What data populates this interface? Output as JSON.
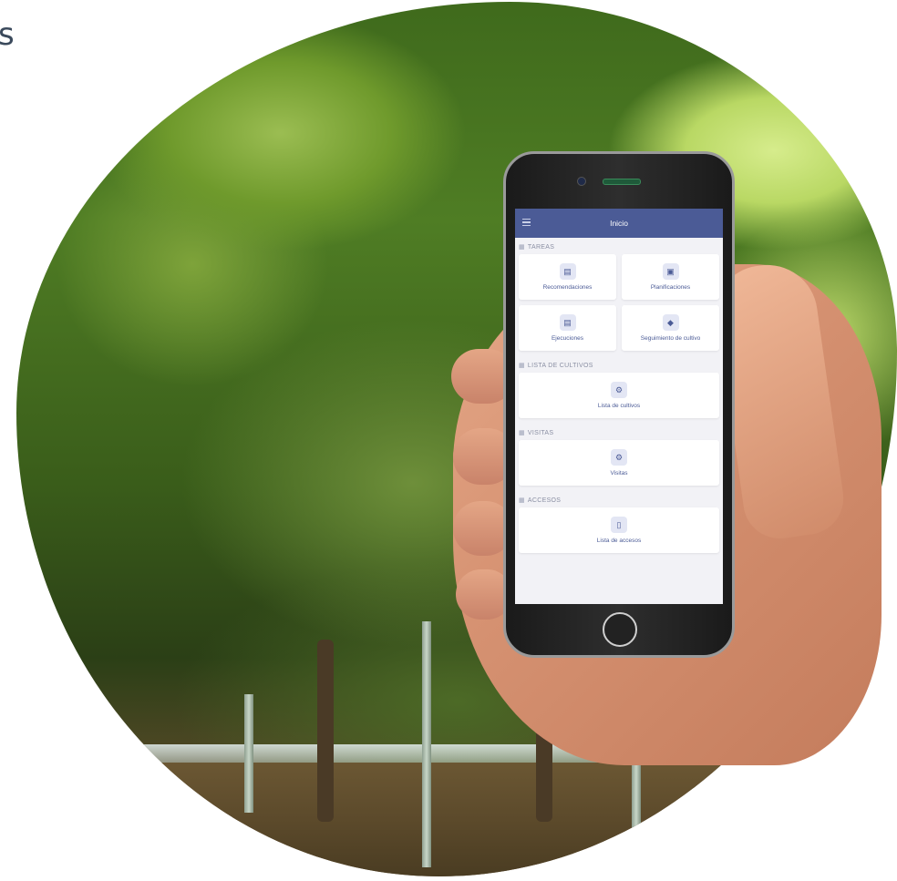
{
  "corner": {
    "text": "s"
  },
  "app": {
    "title": "Inicio",
    "sections": [
      {
        "header": "TAREAS",
        "header_icon": "grid-icon",
        "tiles": [
          {
            "label": "Recomendaciones",
            "icon": "clipboard-icon"
          },
          {
            "label": "Planificaciones",
            "icon": "book-icon"
          },
          {
            "label": "Ejecuciones",
            "icon": "list-icon"
          },
          {
            "label": "Seguimiento de cultivo",
            "icon": "layers-icon"
          }
        ]
      },
      {
        "header": "LISTA DE CULTIVOS",
        "header_icon": "grid-icon",
        "tiles": [
          {
            "label": "Lista de cultivos",
            "icon": "gear-icon"
          }
        ]
      },
      {
        "header": "VISITAS",
        "header_icon": "grid-icon",
        "tiles": [
          {
            "label": "Visitas",
            "icon": "gear-icon"
          }
        ]
      },
      {
        "header": "ACCESOS",
        "header_icon": "grid-icon",
        "tiles": [
          {
            "label": "Lista de accesos",
            "icon": "id-card-icon"
          }
        ]
      }
    ]
  },
  "colors": {
    "appbar": "#4b5b96",
    "accent": "#4b5b96",
    "screen_bg": "#f2f2f6"
  }
}
